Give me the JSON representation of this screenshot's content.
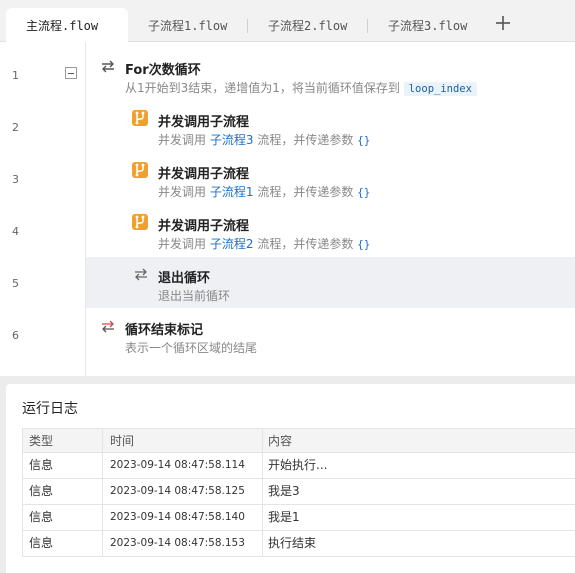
{
  "tabs": [
    {
      "label": "主流程.flow",
      "active": true
    },
    {
      "label": "子流程1.flow",
      "active": false
    },
    {
      "label": "子流程2.flow",
      "active": false
    },
    {
      "label": "子流程3.flow",
      "active": false
    }
  ],
  "add_tab_icon": "plus-icon",
  "editor": {
    "line_numbers": [
      "1",
      "2",
      "3",
      "4",
      "5",
      "6"
    ],
    "steps": [
      {
        "title": "For次数循环",
        "desc_prefix": "从1开始到3结束，递增值为1，将当前循环值保存到",
        "desc_code": "loop_index",
        "icon": "loop-icon"
      },
      {
        "title": "并发调用子流程",
        "desc_prefix": "并发调用",
        "desc_link": "子流程3",
        "desc_suffix": "流程，并传递参数",
        "desc_param": "{}",
        "icon": "subflow-icon"
      },
      {
        "title": "并发调用子流程",
        "desc_prefix": "并发调用",
        "desc_link": "子流程1",
        "desc_suffix": "流程，并传递参数",
        "desc_param": "{}",
        "icon": "subflow-icon"
      },
      {
        "title": "并发调用子流程",
        "desc_prefix": "并发调用",
        "desc_link": "子流程2",
        "desc_suffix": "流程，并传递参数",
        "desc_param": "{}",
        "icon": "subflow-icon"
      },
      {
        "title": "退出循环",
        "desc": "退出当前循环",
        "icon": "exit-loop-icon"
      },
      {
        "title": "循环结束标记",
        "desc": "表示一个循环区域的结尾",
        "icon": "loop-end-icon"
      }
    ]
  },
  "log": {
    "title": "运行日志",
    "columns": [
      "类型",
      "时间",
      "内容"
    ],
    "rows": [
      {
        "type": "信息",
        "time": "2023-09-14 08:47:58.114",
        "content": "开始执行..."
      },
      {
        "type": "信息",
        "time": "2023-09-14 08:47:58.125",
        "content": "我是3"
      },
      {
        "type": "信息",
        "time": "2023-09-14 08:47:58.140",
        "content": "我是1"
      },
      {
        "type": "信息",
        "time": "2023-09-14 08:47:58.153",
        "content": "执行结束"
      }
    ]
  },
  "colors": {
    "accent_link": "#1b6fc8",
    "subflow_icon": "#f0a030",
    "highlight_row": "#eef0f3"
  }
}
